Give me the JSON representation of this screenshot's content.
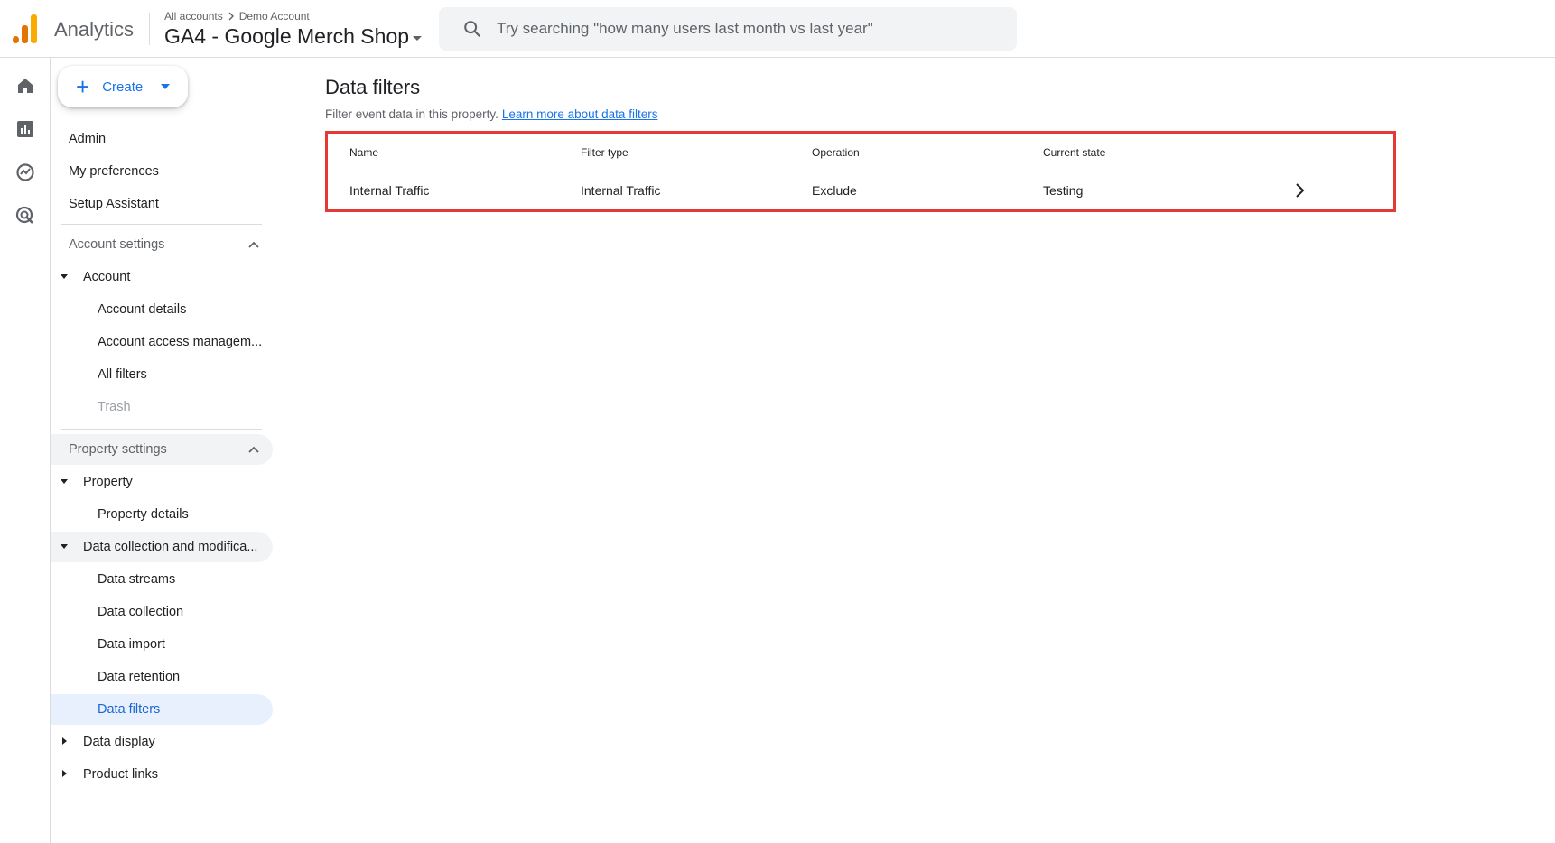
{
  "header": {
    "app_name": "Analytics",
    "breadcrumb": [
      "All accounts",
      "Demo Account"
    ],
    "property_name": "GA4 - Google Merch Shop",
    "search_placeholder": "Try searching \"how many users last month vs last year\""
  },
  "rail": {
    "icons": [
      "home-icon",
      "reports-icon",
      "explore-icon",
      "advertising-icon"
    ]
  },
  "sidebar": {
    "create_label": "Create",
    "items": [
      {
        "label": "Admin"
      },
      {
        "label": "My preferences"
      },
      {
        "label": "Setup Assistant"
      },
      {
        "label": "Account settings"
      },
      {
        "label": "Account"
      },
      {
        "label": "Account details"
      },
      {
        "label": "Account access managem..."
      },
      {
        "label": "All filters"
      },
      {
        "label": "Trash"
      },
      {
        "label": "Property settings"
      },
      {
        "label": "Property"
      },
      {
        "label": "Property details"
      },
      {
        "label": "Data collection and modifica..."
      },
      {
        "label": "Data streams"
      },
      {
        "label": "Data collection"
      },
      {
        "label": "Data import"
      },
      {
        "label": "Data retention"
      },
      {
        "label": "Data filters"
      },
      {
        "label": "Data display"
      },
      {
        "label": "Product links"
      }
    ]
  },
  "main": {
    "title": "Data filters",
    "subtitle": "Filter event data in this property.",
    "learn_more": "Learn more about data filters",
    "table": {
      "headers": [
        "Name",
        "Filter type",
        "Operation",
        "Current state"
      ],
      "rows": [
        [
          "Internal Traffic",
          "Internal Traffic",
          "Exclude",
          "Testing"
        ]
      ]
    }
  },
  "colors": {
    "accent": "#1a73e8",
    "active_bg": "#e8f0fe",
    "highlight_border": "#e53935"
  }
}
